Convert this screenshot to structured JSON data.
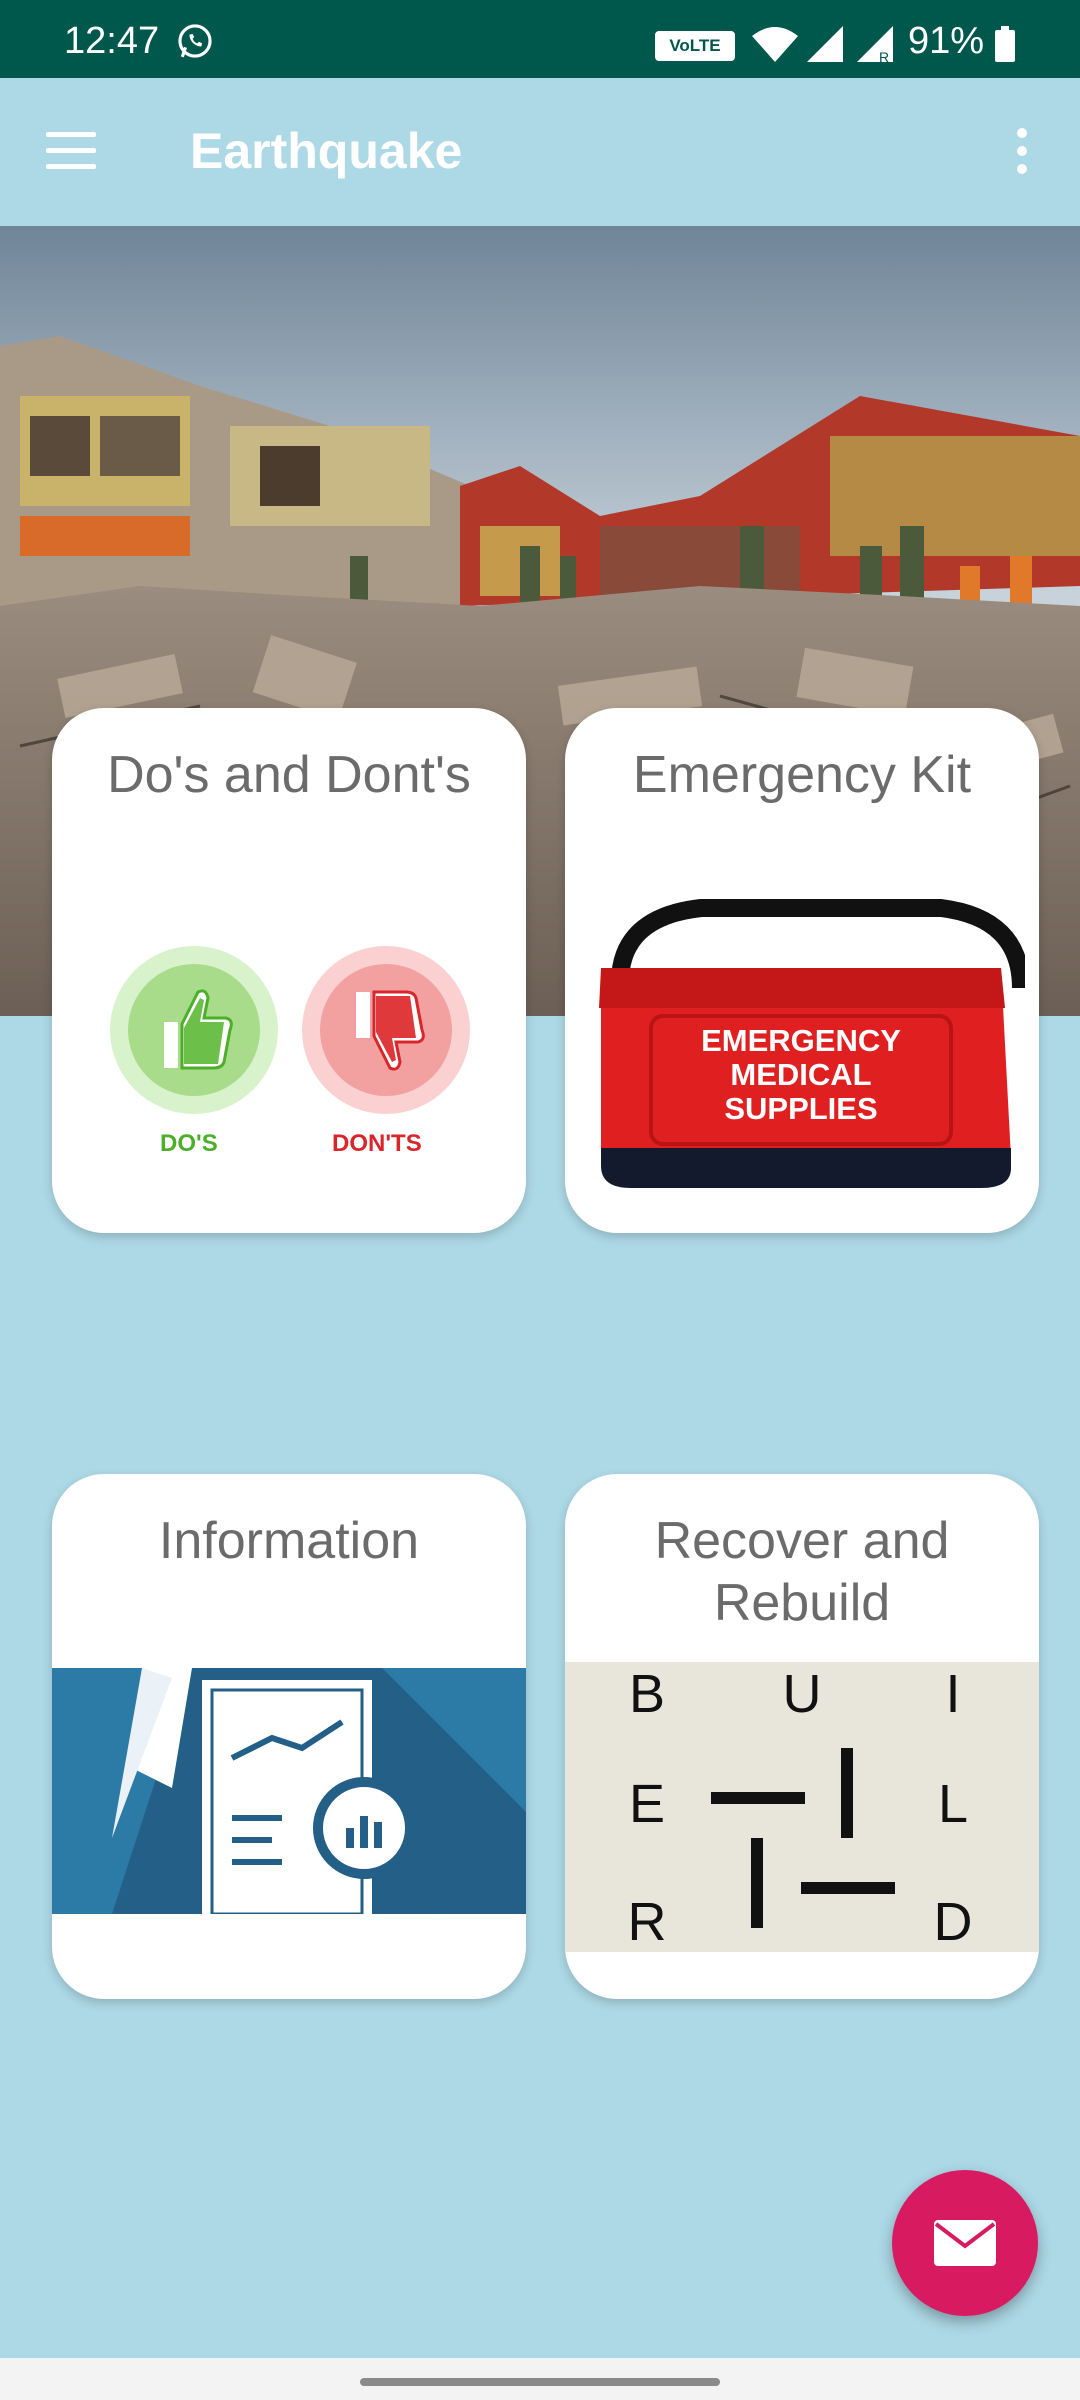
{
  "status_bar": {
    "time": "12:47",
    "volte": "VoLTE",
    "battery": "91%",
    "icons": [
      "whatsapp-icon",
      "wifi-icon",
      "signal-icon",
      "signal-roaming-icon",
      "battery-icon"
    ]
  },
  "app_bar": {
    "title": "Earthquake",
    "icons": [
      "menu-icon",
      "more-vert-icon"
    ]
  },
  "cards": [
    {
      "title": "Do's and Dont's",
      "dos_label": "DO'S",
      "donts_label": "DON'TS"
    },
    {
      "title": "Emergency Kit",
      "bag_text": [
        "EMERGENCY",
        "MEDICAL",
        "SUPPLIES"
      ]
    },
    {
      "title": "Information"
    },
    {
      "title": "Recover and Rebuild",
      "letters": [
        "B",
        "U",
        "I",
        "E",
        "L",
        "R",
        "D"
      ]
    }
  ],
  "fab": {
    "icon": "mail-icon"
  },
  "colors": {
    "status_bar": "#00574b",
    "background": "#add8e6",
    "fab": "#d81b60",
    "dos": "#4caf2a",
    "donts": "#d9262a",
    "info_blue": "#2c7aa6",
    "kit_red": "#e02020"
  }
}
